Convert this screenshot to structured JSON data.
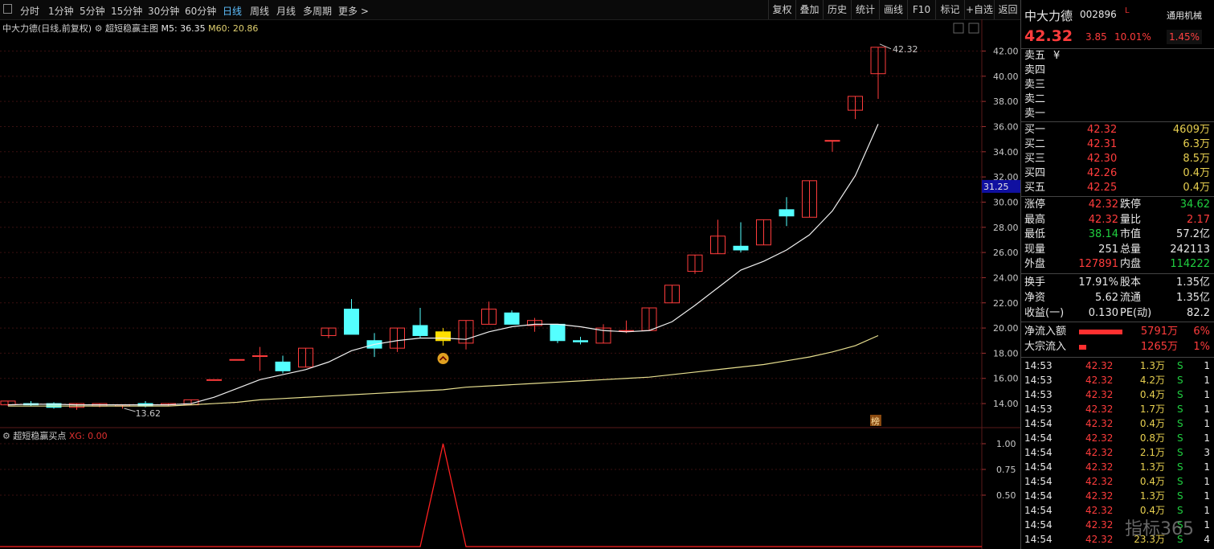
{
  "toolbar": {
    "periods": [
      "分时",
      "1分钟",
      "5分钟",
      "15分钟",
      "30分钟",
      "60分钟",
      "日线",
      "周线",
      "月线",
      "多周期",
      "更多 >"
    ],
    "active_period": "日线",
    "tools": [
      "复权",
      "叠加",
      "历史",
      "统计",
      "画线",
      "F10",
      "标记",
      "+自选",
      "返回"
    ]
  },
  "main_chart": {
    "title": "中大力德(日线,前复权)",
    "indicator": "超短稳赢主图",
    "m5": "M5: 36.35",
    "m60": "M60: 20.86",
    "high_label": "42.32",
    "low_label": "13.62",
    "crosshair_price": "31.25",
    "badge_text": "榜",
    "price_ticks": [
      "42.00",
      "40.00",
      "38.00",
      "36.00",
      "34.00",
      "32.00",
      "30.00",
      "28.00",
      "26.00",
      "24.00",
      "22.00",
      "20.00",
      "18.00",
      "16.00",
      "14.00"
    ]
  },
  "sub_chart": {
    "title": "超短稳赢买点",
    "xg": "XG: 0.00",
    "ticks": [
      "1.00",
      "0.75",
      "0.50"
    ]
  },
  "chart_data": {
    "type": "candlestick",
    "ylim": [
      12.6,
      43.5
    ],
    "candles": [
      {
        "o": 13.9,
        "c": 14.2,
        "h": 14.2,
        "l": 13.8
      },
      {
        "o": 14.0,
        "c": 13.9,
        "h": 14.2,
        "l": 13.8
      },
      {
        "o": 14.0,
        "c": 13.7,
        "h": 14.1,
        "l": 13.6
      },
      {
        "o": 13.7,
        "c": 14.0,
        "h": 14.0,
        "l": 13.5
      },
      {
        "o": 13.8,
        "c": 14.0,
        "h": 14.0,
        "l": 13.7
      },
      {
        "o": 13.8,
        "c": 13.9,
        "h": 13.9,
        "l": 13.6
      },
      {
        "o": 14.0,
        "c": 13.8,
        "h": 14.2,
        "l": 13.7
      },
      {
        "o": 13.9,
        "c": 14.0,
        "h": 14.0,
        "l": 13.8
      },
      {
        "o": 13.9,
        "c": 14.3,
        "h": 14.3,
        "l": 13.9
      },
      {
        "o": 15.9,
        "c": 15.9,
        "h": 15.9,
        "l": 15.9
      },
      {
        "o": 17.5,
        "c": 17.5,
        "h": 17.5,
        "l": 17.5
      },
      {
        "o": 17.8,
        "c": 17.8,
        "h": 18.5,
        "l": 16.6
      },
      {
        "o": 17.3,
        "c": 16.6,
        "h": 17.8,
        "l": 16.4
      },
      {
        "o": 16.9,
        "c": 18.4,
        "h": 18.4,
        "l": 16.9
      },
      {
        "o": 19.4,
        "c": 20.0,
        "h": 20.0,
        "l": 19.2
      },
      {
        "o": 21.5,
        "c": 19.5,
        "h": 22.3,
        "l": 19.5
      },
      {
        "o": 19.0,
        "c": 18.4,
        "h": 19.6,
        "l": 17.7
      },
      {
        "o": 18.4,
        "c": 20.0,
        "h": 20.0,
        "l": 18.1
      },
      {
        "o": 20.2,
        "c": 19.4,
        "h": 21.6,
        "l": 19.2
      },
      {
        "o": 19.7,
        "c": 19.0,
        "h": 20.0,
        "l": 18.6
      },
      {
        "o": 18.8,
        "c": 20.6,
        "h": 20.6,
        "l": 18.3
      },
      {
        "o": 20.3,
        "c": 21.5,
        "h": 22.1,
        "l": 20.3
      },
      {
        "o": 21.2,
        "c": 20.3,
        "h": 21.4,
        "l": 20.3
      },
      {
        "o": 20.2,
        "c": 20.6,
        "h": 20.8,
        "l": 19.7
      },
      {
        "o": 20.3,
        "c": 19.0,
        "h": 20.3,
        "l": 18.8
      },
      {
        "o": 19.0,
        "c": 18.9,
        "h": 19.3,
        "l": 18.7
      },
      {
        "o": 18.8,
        "c": 20.0,
        "h": 20.3,
        "l": 18.8
      },
      {
        "o": 19.8,
        "c": 19.8,
        "h": 20.6,
        "l": 19.6
      },
      {
        "o": 19.8,
        "c": 21.6,
        "h": 21.6,
        "l": 19.8
      },
      {
        "o": 22.0,
        "c": 23.4,
        "h": 23.4,
        "l": 22.0
      },
      {
        "o": 24.5,
        "c": 25.8,
        "h": 25.8,
        "l": 24.3
      },
      {
        "o": 25.9,
        "c": 27.3,
        "h": 28.6,
        "l": 25.9
      },
      {
        "o": 26.5,
        "c": 26.2,
        "h": 28.4,
        "l": 26.0
      },
      {
        "o": 26.6,
        "c": 28.6,
        "h": 28.6,
        "l": 26.6
      },
      {
        "o": 29.4,
        "c": 28.9,
        "h": 30.4,
        "l": 28.1
      },
      {
        "o": 28.8,
        "c": 31.7,
        "h": 31.7,
        "l": 28.8
      },
      {
        "o": 34.9,
        "c": 34.9,
        "h": 34.9,
        "l": 34.0
      },
      {
        "o": 37.3,
        "c": 38.4,
        "h": 38.4,
        "l": 36.6
      },
      {
        "o": 40.2,
        "c": 42.3,
        "h": 42.3,
        "l": 38.2
      }
    ],
    "highlight_candle": 19,
    "buy_signal_candle": 19,
    "m5_series": [
      13.9,
      13.95,
      13.95,
      13.9,
      13.9,
      13.9,
      13.9,
      13.9,
      14.0,
      14.5,
      15.2,
      15.9,
      16.3,
      16.7,
      17.3,
      18.2,
      18.7,
      19.0,
      19.2,
      19.2,
      19.1,
      19.7,
      20.1,
      20.3,
      20.3,
      20.1,
      19.8,
      19.7,
      19.8,
      20.5,
      21.8,
      23.2,
      24.6,
      25.3,
      26.2,
      27.4,
      29.3,
      32.1,
      36.2
    ],
    "m60_series": [
      13.8,
      13.8,
      13.8,
      13.8,
      13.8,
      13.8,
      13.8,
      13.8,
      13.9,
      14.0,
      14.1,
      14.3,
      14.4,
      14.5,
      14.6,
      14.7,
      14.8,
      14.9,
      15.0,
      15.1,
      15.3,
      15.4,
      15.5,
      15.6,
      15.7,
      15.8,
      15.9,
      16.0,
      16.1,
      16.3,
      16.5,
      16.7,
      16.9,
      17.1,
      17.4,
      17.7,
      18.1,
      18.6,
      19.4
    ],
    "signal_series": [
      0,
      0,
      0,
      0,
      0,
      0,
      0,
      0,
      0,
      0,
      0,
      0,
      0,
      0,
      0,
      0,
      0,
      0,
      0,
      1,
      0,
      0,
      0,
      0,
      0,
      0,
      0,
      0,
      0,
      0,
      0,
      0,
      0,
      0,
      0,
      0,
      0,
      0,
      0
    ]
  },
  "quote": {
    "name": "中大力德",
    "code": "002896",
    "l_mark": "L",
    "industry": "通用机械",
    "industry_pct": "1.45%",
    "price": "42.32",
    "change": "3.85",
    "change_pct": "10.01%",
    "asks": [
      {
        "label": "卖五",
        "price": "¥",
        "vol": ""
      },
      {
        "label": "卖四",
        "price": "",
        "vol": ""
      },
      {
        "label": "卖三",
        "price": "",
        "vol": ""
      },
      {
        "label": "卖二",
        "price": "",
        "vol": ""
      },
      {
        "label": "卖一",
        "price": "",
        "vol": ""
      }
    ],
    "bids": [
      {
        "label": "买一",
        "price": "42.32",
        "vol": "4609万"
      },
      {
        "label": "买二",
        "price": "42.31",
        "vol": "6.3万"
      },
      {
        "label": "买三",
        "price": "42.30",
        "vol": "8.5万"
      },
      {
        "label": "买四",
        "price": "42.26",
        "vol": "0.4万"
      },
      {
        "label": "买五",
        "price": "42.25",
        "vol": "0.4万"
      }
    ],
    "stats": [
      {
        "l1": "涨停",
        "v1": "42.32",
        "c1": "red",
        "l2": "跌停",
        "v2": "34.62",
        "c2": "green"
      },
      {
        "l1": "最高",
        "v1": "42.32",
        "c1": "red",
        "l2": "量比",
        "v2": "2.17",
        "c2": "red"
      },
      {
        "l1": "最低",
        "v1": "38.14",
        "c1": "green",
        "l2": "市值",
        "v2": "57.2亿",
        "c2": "wht"
      },
      {
        "l1": "现量",
        "v1": "251",
        "c1": "wht",
        "l2": "总量",
        "v2": "242113",
        "c2": "wht"
      },
      {
        "l1": "外盘",
        "v1": "127891",
        "c1": "red",
        "l2": "内盘",
        "v2": "114222",
        "c2": "green"
      }
    ],
    "stats2": [
      {
        "l1": "换手",
        "v1": "17.91%",
        "l2": "股本",
        "v2": "1.35亿"
      },
      {
        "l1": "净资",
        "v1": "5.62",
        "l2": "流通",
        "v2": "1.35亿"
      },
      {
        "l1": "收益(一)",
        "v1": "0.130",
        "l2": "PE(动)",
        "v2": "82.2"
      }
    ],
    "flows": [
      {
        "label": "净流入额",
        "value": "5791万",
        "pct": "6%",
        "bar": 0.6
      },
      {
        "label": "大宗流入",
        "value": "1265万",
        "pct": "1%",
        "bar": 0.1
      }
    ],
    "trades": [
      {
        "t": "14:53",
        "p": "42.32",
        "v": "1.3万",
        "s": "S",
        "n": "1"
      },
      {
        "t": "14:53",
        "p": "42.32",
        "v": "4.2万",
        "s": "S",
        "n": "1"
      },
      {
        "t": "14:53",
        "p": "42.32",
        "v": "0.4万",
        "s": "S",
        "n": "1"
      },
      {
        "t": "14:53",
        "p": "42.32",
        "v": "1.7万",
        "s": "S",
        "n": "1"
      },
      {
        "t": "14:54",
        "p": "42.32",
        "v": "0.4万",
        "s": "S",
        "n": "1"
      },
      {
        "t": "14:54",
        "p": "42.32",
        "v": "0.8万",
        "s": "S",
        "n": "1"
      },
      {
        "t": "14:54",
        "p": "42.32",
        "v": "2.1万",
        "s": "S",
        "n": "3"
      },
      {
        "t": "14:54",
        "p": "42.32",
        "v": "1.3万",
        "s": "S",
        "n": "1"
      },
      {
        "t": "14:54",
        "p": "42.32",
        "v": "0.4万",
        "s": "S",
        "n": "1"
      },
      {
        "t": "14:54",
        "p": "42.32",
        "v": "1.3万",
        "s": "S",
        "n": "1"
      },
      {
        "t": "14:54",
        "p": "42.32",
        "v": "0.4万",
        "s": "S",
        "n": "1"
      },
      {
        "t": "14:54",
        "p": "42.32",
        "v": "",
        "s": "S",
        "n": "1"
      },
      {
        "t": "14:54",
        "p": "42.32",
        "v": "23.3万",
        "s": "S",
        "n": "4"
      }
    ]
  },
  "watermark": "指标365"
}
